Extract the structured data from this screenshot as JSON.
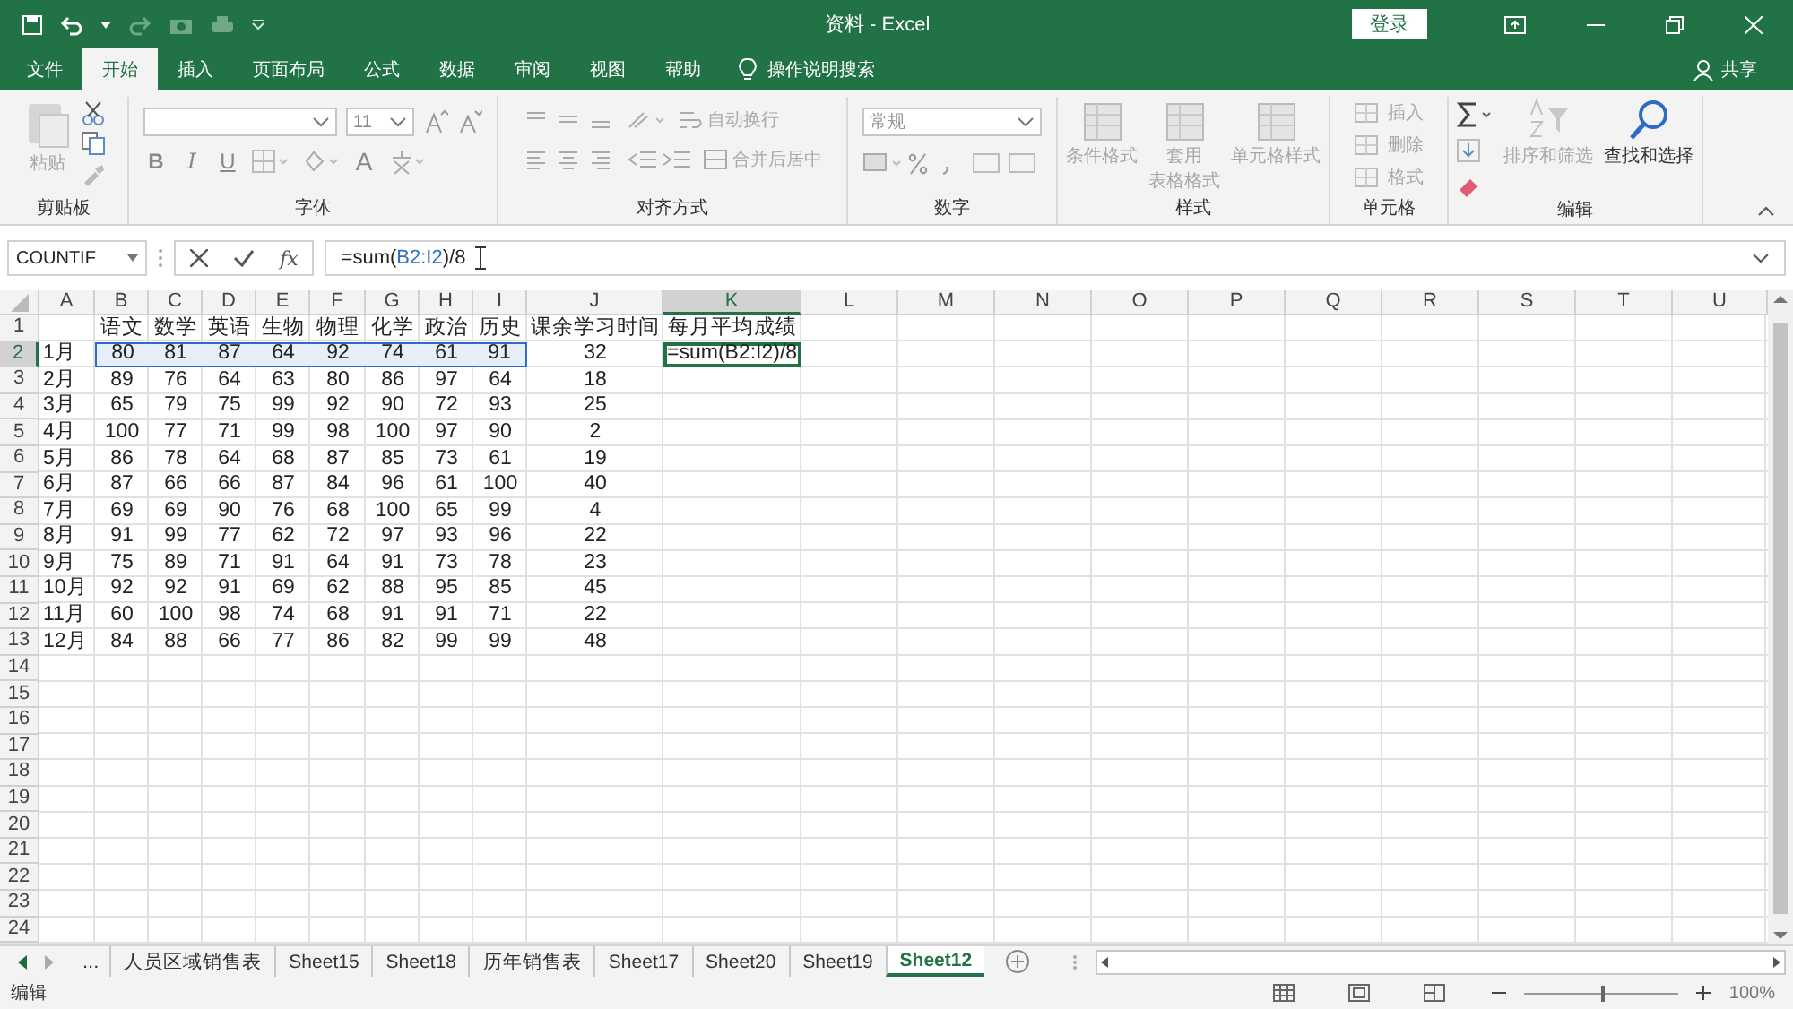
{
  "window": {
    "title": "资料 - Excel",
    "sign_in": "登录"
  },
  "ribbon_tabs": [
    {
      "label": "文件",
      "selected": false
    },
    {
      "label": "开始",
      "selected": true
    },
    {
      "label": "插入",
      "selected": false
    },
    {
      "label": "页面布局",
      "selected": false
    },
    {
      "label": "公式",
      "selected": false
    },
    {
      "label": "数据",
      "selected": false
    },
    {
      "label": "审阅",
      "selected": false
    },
    {
      "label": "视图",
      "selected": false
    },
    {
      "label": "帮助",
      "selected": false
    }
  ],
  "tell_me": "操作说明搜索",
  "share": "共享",
  "ribbon": {
    "groups": [
      {
        "label": "剪贴板",
        "paste": {
          "label": "粘贴",
          "disabled": true
        }
      },
      {
        "label": "字体",
        "font_size": "11",
        "bold": "B",
        "italic": "I",
        "underline": "U",
        "font_color": "A"
      },
      {
        "label": "对齐方式",
        "wrap": "自动换行",
        "merge": "合并后居中"
      },
      {
        "label": "数字",
        "format": "常规"
      },
      {
        "label": "样式",
        "buttons": [
          {
            "lines": [
              "条件格式"
            ],
            "disabled": true
          },
          {
            "lines": [
              "套用",
              "表格格式"
            ],
            "disabled": true
          },
          {
            "lines": [
              "单元格样式"
            ],
            "disabled": true
          }
        ]
      },
      {
        "label": "单元格",
        "buttons": [
          {
            "label": "插入",
            "disabled": true
          },
          {
            "label": "删除",
            "disabled": true
          },
          {
            "label": "格式",
            "disabled": true
          }
        ]
      },
      {
        "label": "编辑",
        "sort": {
          "label": "排序和筛选",
          "disabled": true
        },
        "find": {
          "label": "查找和选择",
          "disabled": false
        }
      }
    ]
  },
  "formula_bar": {
    "name_box": "COUNTIF",
    "function_label": "fx",
    "formula": [
      {
        "text": "=sum(",
        "kind": "plain"
      },
      {
        "text": "B2:I2",
        "kind": "ref"
      },
      {
        "text": ")/8",
        "kind": "plain"
      }
    ]
  },
  "sheet": {
    "columns": [
      {
        "label": "A",
        "selected": false
      },
      {
        "label": "B",
        "selected": false
      },
      {
        "label": "C",
        "selected": false
      },
      {
        "label": "D",
        "selected": false
      },
      {
        "label": "E",
        "selected": false
      },
      {
        "label": "F",
        "selected": false
      },
      {
        "label": "G",
        "selected": false
      },
      {
        "label": "H",
        "selected": false
      },
      {
        "label": "I",
        "selected": false
      },
      {
        "label": "J",
        "selected": false
      },
      {
        "label": "K",
        "selected": true
      },
      {
        "label": "L",
        "selected": false
      },
      {
        "label": "M",
        "selected": false
      },
      {
        "label": "N",
        "selected": false
      },
      {
        "label": "O",
        "selected": false
      },
      {
        "label": "P",
        "selected": false
      },
      {
        "label": "Q",
        "selected": false
      },
      {
        "label": "R",
        "selected": false
      },
      {
        "label": "S",
        "selected": false
      },
      {
        "label": "T",
        "selected": false
      },
      {
        "label": "U",
        "selected": false
      }
    ],
    "rows": [
      {
        "number": "1",
        "selected": false,
        "cells": [
          "",
          "语文",
          "数学",
          "英语",
          "生物",
          "物理",
          "化学",
          "政治",
          "历史",
          "课余学习时间",
          "每月平均成绩"
        ]
      },
      {
        "number": "2",
        "selected": true,
        "cells": [
          "1月",
          {
            "text": "80",
            "kind": "range"
          },
          {
            "text": "81",
            "kind": "range"
          },
          {
            "text": "87",
            "kind": "range"
          },
          {
            "text": "64",
            "kind": "range"
          },
          {
            "text": "92",
            "kind": "range"
          },
          {
            "text": "74",
            "kind": "range"
          },
          {
            "text": "61",
            "kind": "range"
          },
          {
            "text": "91",
            "kind": "range"
          },
          "32",
          {
            "text": "=sum(B2:I2)/8",
            "kind": "active"
          }
        ]
      },
      {
        "number": "3",
        "selected": false,
        "cells": [
          "2月",
          "89",
          "76",
          "64",
          "63",
          "80",
          "86",
          "97",
          "64",
          "18"
        ]
      },
      {
        "number": "4",
        "selected": false,
        "cells": [
          "3月",
          "65",
          "79",
          "75",
          "99",
          "92",
          "90",
          "72",
          "93",
          "25"
        ]
      },
      {
        "number": "5",
        "selected": false,
        "cells": [
          "4月",
          "100",
          "77",
          "71",
          "99",
          "98",
          "100",
          "97",
          "90",
          "2"
        ]
      },
      {
        "number": "6",
        "selected": false,
        "cells": [
          "5月",
          "86",
          "78",
          "64",
          "68",
          "87",
          "85",
          "73",
          "61",
          "19"
        ]
      },
      {
        "number": "7",
        "selected": false,
        "cells": [
          "6月",
          "87",
          "66",
          "66",
          "87",
          "84",
          "96",
          "61",
          "100",
          "40"
        ]
      },
      {
        "number": "8",
        "selected": false,
        "cells": [
          "7月",
          "69",
          "69",
          "90",
          "76",
          "68",
          "100",
          "65",
          "99",
          "4"
        ]
      },
      {
        "number": "9",
        "selected": false,
        "cells": [
          "8月",
          "91",
          "99",
          "77",
          "62",
          "72",
          "97",
          "93",
          "96",
          "22"
        ]
      },
      {
        "number": "10",
        "selected": false,
        "cells": [
          "9月",
          "75",
          "89",
          "71",
          "91",
          "64",
          "91",
          "73",
          "78",
          "23"
        ]
      },
      {
        "number": "11",
        "selected": false,
        "cells": [
          "10月",
          "92",
          "92",
          "91",
          "69",
          "62",
          "88",
          "95",
          "85",
          "45"
        ]
      },
      {
        "number": "12",
        "selected": false,
        "cells": [
          "11月",
          "60",
          "100",
          "98",
          "74",
          "68",
          "91",
          "91",
          "71",
          "22"
        ]
      },
      {
        "number": "13",
        "selected": false,
        "cells": [
          "12月",
          "84",
          "88",
          "66",
          "77",
          "86",
          "82",
          "99",
          "99",
          "48"
        ]
      },
      {
        "number": "14",
        "selected": false
      },
      {
        "number": "15",
        "selected": false
      },
      {
        "number": "16",
        "selected": false
      },
      {
        "number": "17",
        "selected": false
      },
      {
        "number": "18",
        "selected": false
      },
      {
        "number": "19",
        "selected": false
      },
      {
        "number": "20",
        "selected": false
      },
      {
        "number": "21",
        "selected": false
      },
      {
        "number": "22",
        "selected": false
      },
      {
        "number": "23",
        "selected": false
      },
      {
        "number": "24",
        "selected": false
      }
    ]
  },
  "sheet_tabs": {
    "more": "...",
    "tabs": [
      {
        "label": "人员区域销售表",
        "selected": false
      },
      {
        "label": "Sheet15",
        "selected": false
      },
      {
        "label": "Sheet18",
        "selected": false
      },
      {
        "label": "历年销售表",
        "selected": false
      },
      {
        "label": "Sheet17",
        "selected": false
      },
      {
        "label": "Sheet20",
        "selected": false
      },
      {
        "label": "Sheet19",
        "selected": false
      },
      {
        "label": "Sheet12",
        "selected": true
      }
    ]
  },
  "status_bar": {
    "mode": "编辑",
    "zoom": {
      "level": 0.5,
      "reading": "100%"
    }
  }
}
